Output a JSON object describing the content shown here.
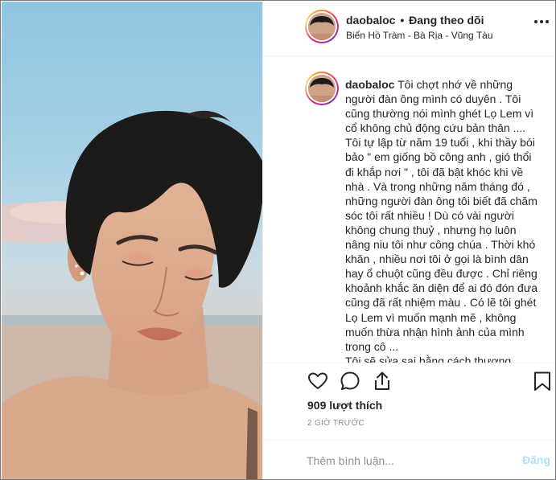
{
  "header": {
    "username": "daobaloc",
    "separator": "•",
    "follow_status": "Đang theo dõi",
    "location": "Biển Hồ Tràm - Bà Rịa - Vũng Tàu",
    "more_icon": "more-horizontal-icon"
  },
  "caption": {
    "username": "daobaloc",
    "text": "Tôi chợt nhớ về những người đàn ông mình có duyên . Tôi cũng thường nói mình ghét Lọ Lem vì cổ không chủ động cứu bản thân .... Tôi tự lập từ năm 19 tuổi , khi thầy bói bảo \" em giống bồ công anh , gió thổi đi khắp nơi \" , tôi đã bật khóc khi về nhà . Và trong những năm tháng đó , những người đàn ông tôi biết đã chăm sóc tôi rất nhiều ! Dù có vài người không chung thuỷ , nhưng họ luôn nâng niu tôi như công chúa . Thời khó khăn , nhiều nơi tôi ở gọi là bình dân hay ổ chuột cũng đều được . Chỉ riêng khoảnh khắc ăn diện để ai đó đón đưa cũng đã rất nhiệm màu . Có lẽ tôi ghét Lọ Lem vì muốn mạnh mẽ , không muốn thừa nhận hình ảnh của mình trong cô ...\nTôi sẽ sửa sai bằng cách thương người"
  },
  "actions": {
    "like_icon": "heart-icon",
    "comment_icon": "comment-icon",
    "share_icon": "share-icon",
    "save_icon": "bookmark-icon"
  },
  "likes": "909 lượt thích",
  "time_ago": "2 GIỜ TRƯỚC",
  "comment_box": {
    "placeholder": "Thêm bình luận...",
    "post_label": "Đăng"
  },
  "colors": {
    "text": "#262626",
    "muted": "#8e8e8e",
    "divider": "#efefef",
    "post_disabled": "#b2dffc"
  }
}
